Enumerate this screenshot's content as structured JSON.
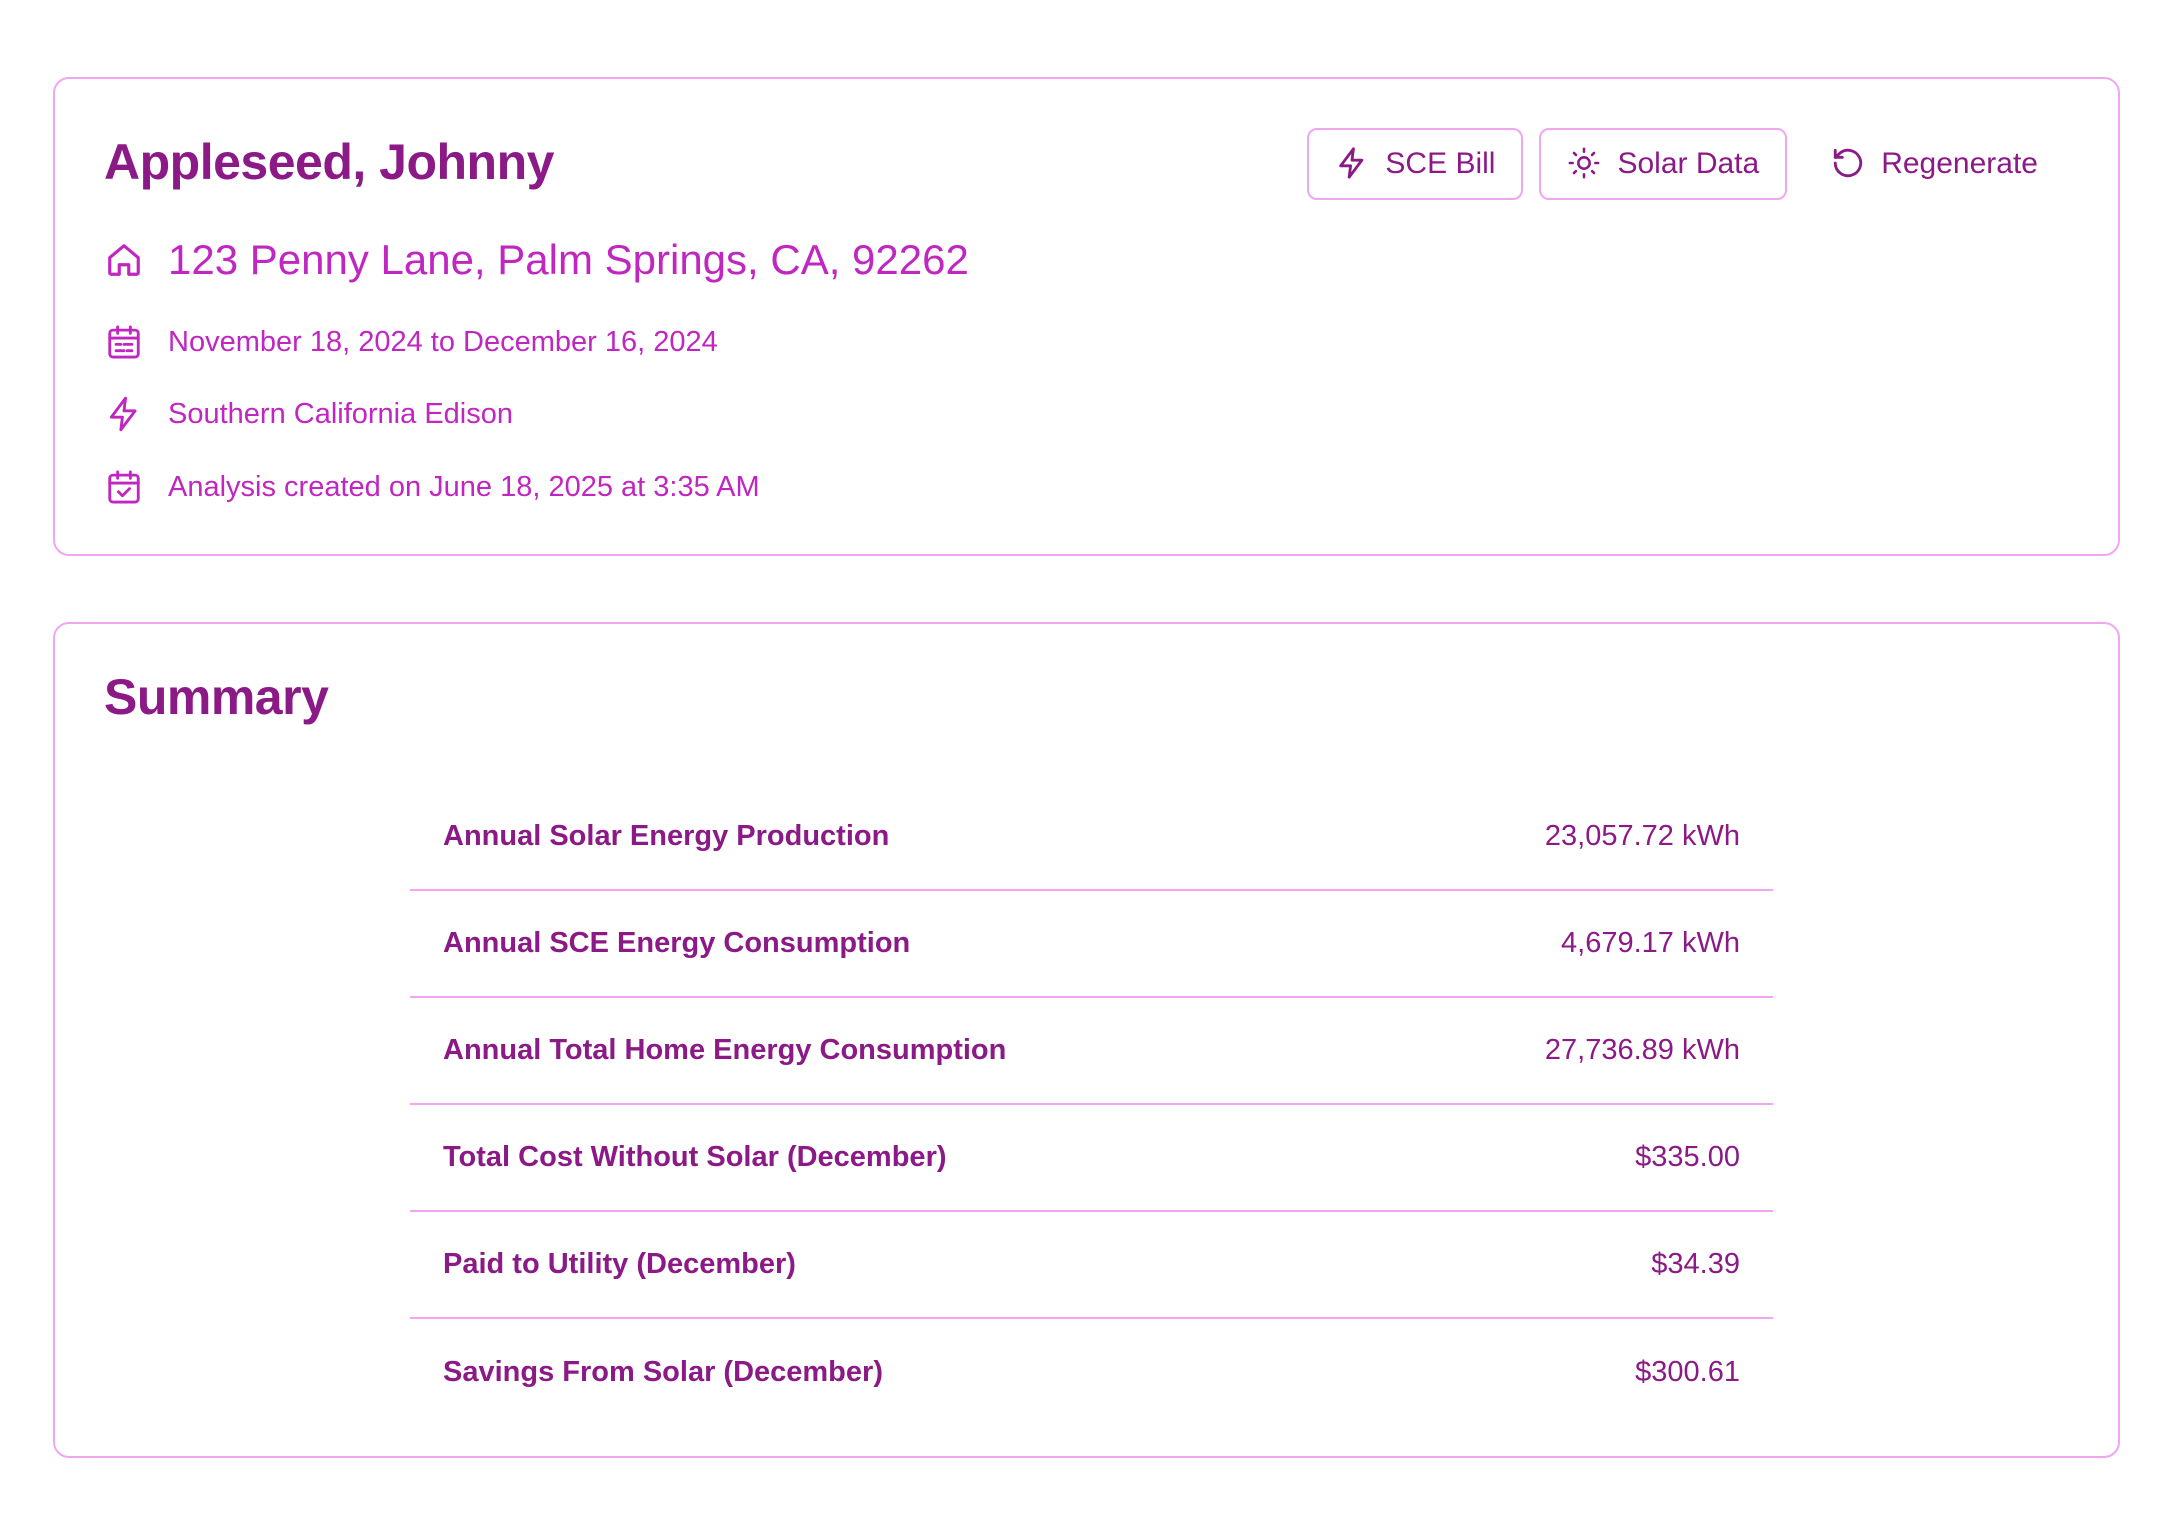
{
  "header": {
    "customer_name": "Appleseed, Johnny",
    "address": "123 Penny Lane, Palm Springs, CA, 92262",
    "billing_period": "November 18, 2024 to December 16, 2024",
    "utility": "Southern California Edison",
    "created": "Analysis created on June 18, 2025 at 3:35 AM",
    "icons": {
      "address": "home-icon",
      "period": "calendar-icon",
      "utility": "lightning-icon",
      "created": "calendar-check-icon"
    }
  },
  "actions": {
    "sce_bill_label": "SCE Bill",
    "solar_data_label": "Solar Data",
    "regenerate_label": "Regenerate"
  },
  "summary": {
    "title": "Summary",
    "rows": [
      {
        "label": "Annual Solar Energy Production",
        "value": "23,057.72 kWh"
      },
      {
        "label": "Annual SCE Energy Consumption",
        "value": "4,679.17 kWh"
      },
      {
        "label": "Annual Total Home Energy Consumption",
        "value": "27,736.89 kWh"
      },
      {
        "label": "Total Cost Without Solar (December)",
        "value": "$335.00"
      },
      {
        "label": "Paid to Utility (December)",
        "value": "$34.39"
      },
      {
        "label": "Savings From Solar (December)",
        "value": "$300.61"
      }
    ]
  },
  "colors": {
    "primary_dark": "#8b1a87",
    "primary": "#c026c0",
    "border": "#f0a6f0"
  }
}
